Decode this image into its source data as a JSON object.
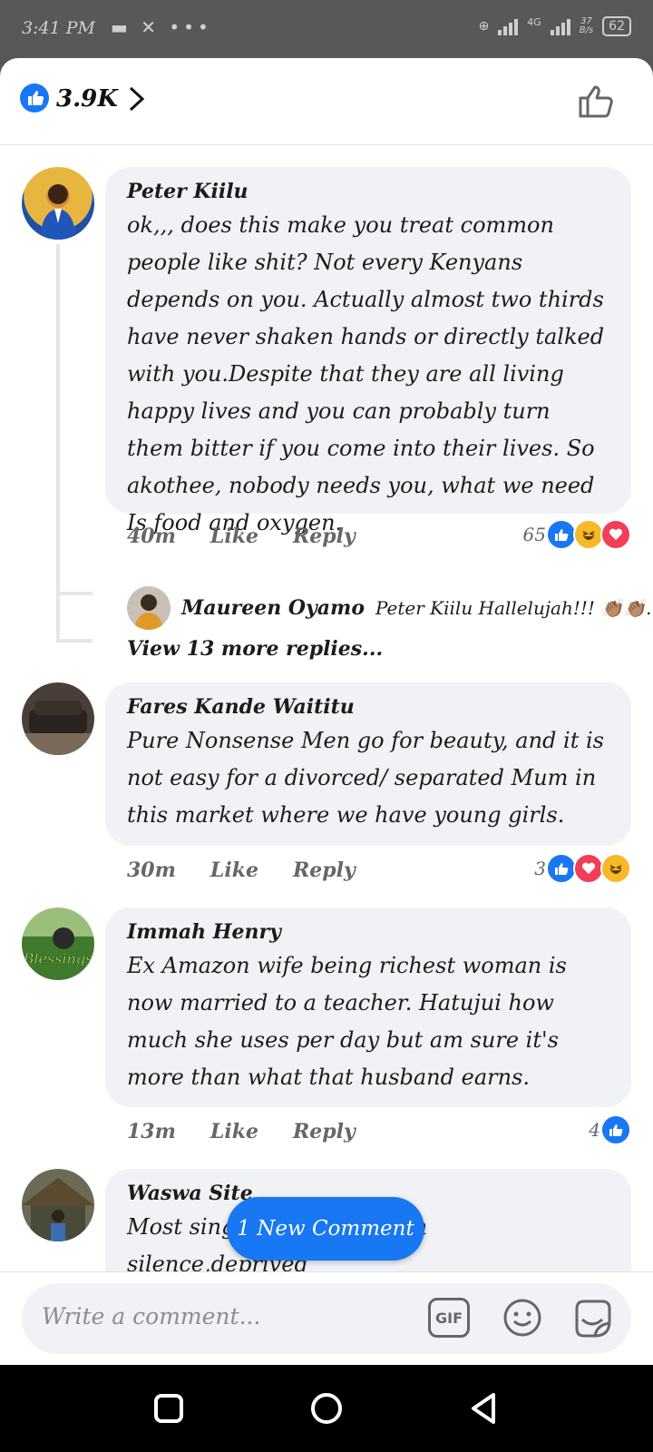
{
  "status_bar": {
    "time": "3:41 PM",
    "network_type": "4G",
    "data_speed": "37",
    "data_speed_unit": "B/s",
    "battery": "62"
  },
  "header": {
    "reaction_count": "3.9K"
  },
  "comments": [
    {
      "author": "Peter Kiilu",
      "text": "ok,,, does this make you treat common people like shit? Not every Kenyans depends on you. Actually almost two thirds have never shaken hands or directly talked with you.Despite that they are all living happy lives and you can probably turn them bitter if you come into their lives. So akothee, nobody needs you, what we need Is food and oxygen.",
      "time": "40m",
      "like_label": "Like",
      "reply_label": "Reply",
      "reaction_count": "65"
    },
    {
      "author": "Fares Kande Waititu",
      "text": "Pure Nonsense Men go for beauty, and it is not easy for a divorced/ separated Mum in this market where we have young girls.",
      "time": "30m",
      "like_label": "Like",
      "reply_label": "Reply",
      "reaction_count": "3"
    },
    {
      "author": "Immah Henry",
      "text": "Ex Amazon wife being  richest woman is now married to a teacher.  Hatujui how much she uses per day but am sure it's more than what that husband earns.",
      "time": "13m",
      "like_label": "Like",
      "reply_label": "Reply",
      "reaction_count": "4"
    },
    {
      "author": "Waswa Site",
      "text": "Most single mums suffer in silence,deprived"
    }
  ],
  "reply_preview": {
    "author": "Maureen Oyamo",
    "text": "Peter Kiilu  Hallelujah!!! 👏🏽👏🏽..."
  },
  "view_more_replies": "View 13 more replies...",
  "new_comment_pill": "1 New Comment",
  "composer": {
    "placeholder": "Write a comment...",
    "gif_label": "GIF"
  },
  "colors": {
    "brand_blue": "#1877f2",
    "love_red": "#f33e58",
    "haha_yellow": "#f7b928",
    "bubble_bg": "#f0f2f5"
  }
}
